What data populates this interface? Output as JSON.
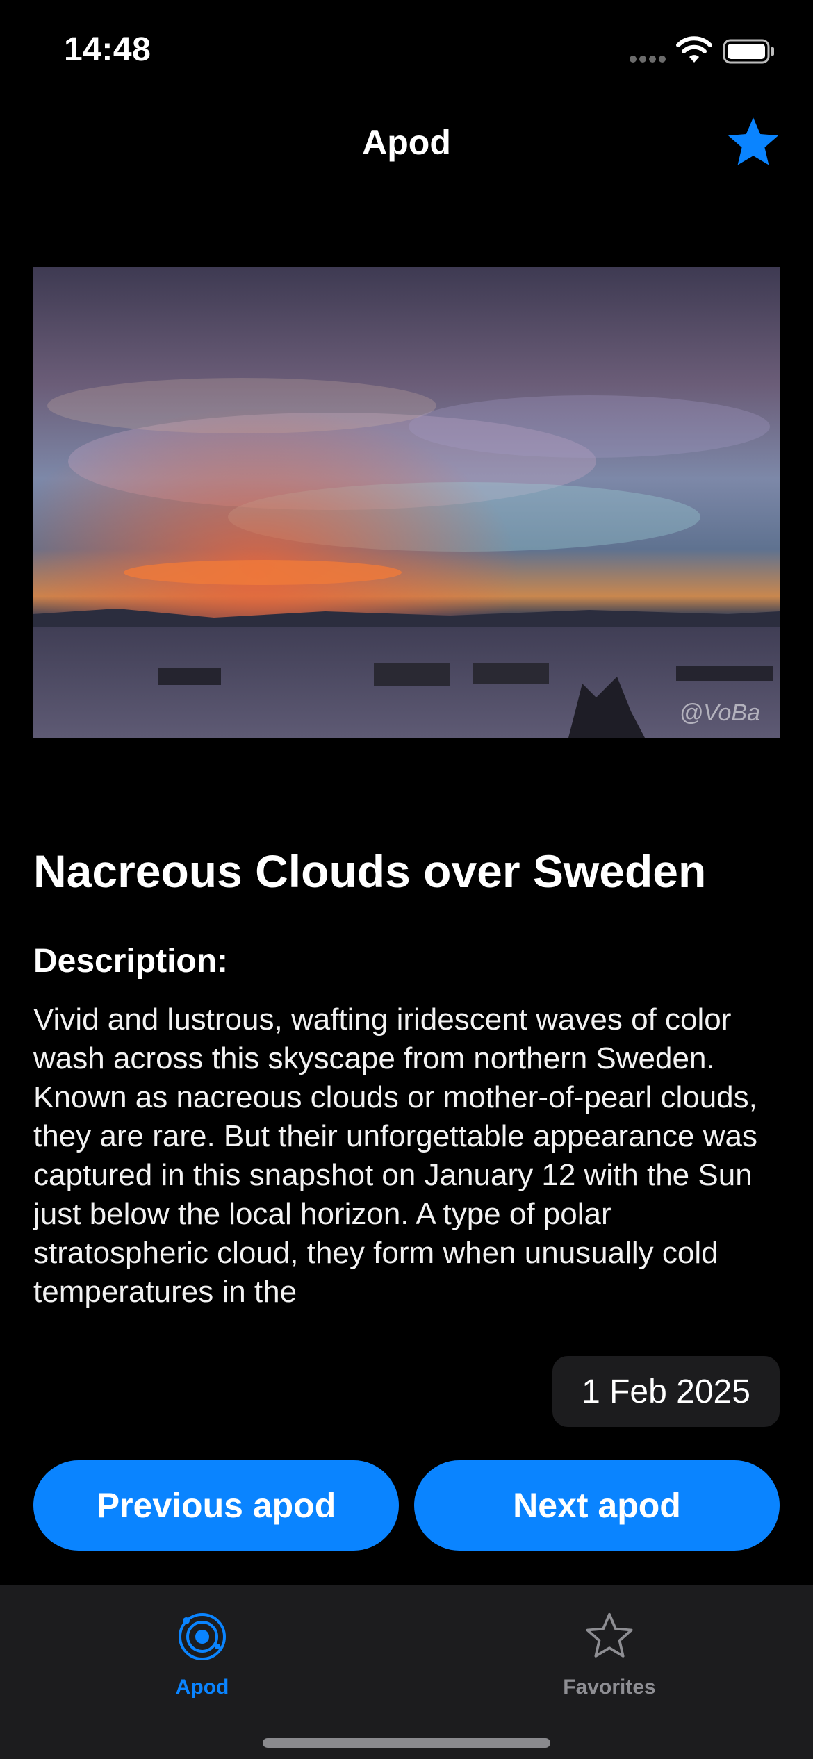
{
  "status_bar": {
    "time": "14:48"
  },
  "nav": {
    "title": "Apod",
    "favorite_icon": "star-filled-icon"
  },
  "photo": {
    "watermark": "@VoBa"
  },
  "apod": {
    "title": "Nacreous Clouds over Sweden",
    "description_heading": "Description:",
    "description": "Vivid and lustrous, wafting iridescent waves of color wash across this skyscape from northern Sweden. Known as nacreous clouds or mother-of-pearl clouds, they are rare. But their unforgettable appearance was captured in this snapshot on January 12 with the Sun just below the local horizon. A type of polar stratospheric cloud, they form when unusually cold temperatures in the",
    "date": "1 Feb 2025"
  },
  "buttons": {
    "previous": "Previous apod",
    "next": "Next apod"
  },
  "tab_bar": {
    "tabs": [
      {
        "label": "Apod",
        "icon": "orbit-icon",
        "active": true
      },
      {
        "label": "Favorites",
        "icon": "star-outline-icon",
        "active": false
      }
    ]
  },
  "colors": {
    "accent": "#0a84ff",
    "background": "#000000",
    "tab_bar": "#1c1c1e",
    "inactive": "#8e8e93"
  }
}
